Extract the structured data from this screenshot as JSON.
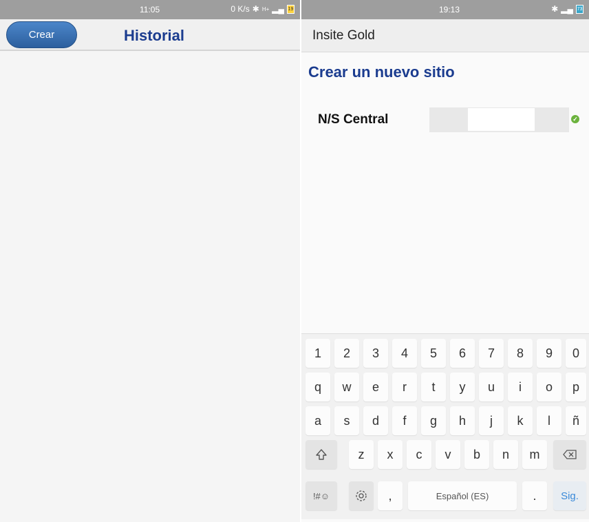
{
  "left": {
    "status": {
      "time": "11:05",
      "speed": "0 K/s",
      "battery": "19"
    },
    "crear_label": "Crear",
    "title": "Historial"
  },
  "right": {
    "status": {
      "time": "19:13",
      "battery": "73"
    },
    "app_title": "Insite Gold",
    "heading": "Crear un nuevo sitio",
    "field_label": "N/S Central",
    "field_value": "",
    "keyboard": {
      "row1": [
        "1",
        "2",
        "3",
        "4",
        "5",
        "6",
        "7",
        "8",
        "9",
        "0"
      ],
      "row2": [
        "q",
        "w",
        "e",
        "r",
        "t",
        "y",
        "u",
        "i",
        "o",
        "p"
      ],
      "row3": [
        "a",
        "s",
        "d",
        "f",
        "g",
        "h",
        "j",
        "k",
        "l",
        "ñ"
      ],
      "row4": [
        "z",
        "x",
        "c",
        "v",
        "b",
        "n",
        "m"
      ],
      "symbols_label": "!#☺",
      "comma": ",",
      "space_label": "Español (ES)",
      "period": ".",
      "next_label": "Sig."
    }
  }
}
